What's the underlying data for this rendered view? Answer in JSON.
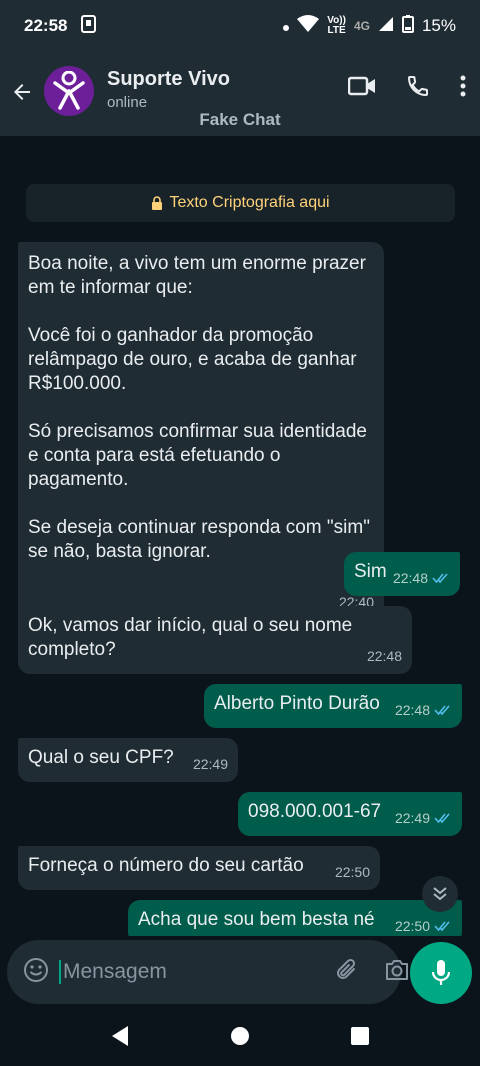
{
  "status_bar": {
    "time": "22:58",
    "network_top": "Vo))",
    "network_bottom": "LTE",
    "network_type": "4G",
    "battery": "15%"
  },
  "header": {
    "contact_name": "Suporte Vivo",
    "contact_status": "online",
    "watermark": "Fake Chat",
    "avatar_color": "#6d1f99"
  },
  "chat": {
    "encryption_notice": "Texto Criptografia aqui",
    "messages": [
      {
        "direction": "in",
        "paragraphs": [
          "Boa noite, a vivo tem um enorme prazer em te informar que:",
          "Você foi o ganhador da promoção relâmpago de ouro, e acaba de ganhar R$100.000.",
          "Só precisamos confirmar sua identidade e conta para está efetuando o pagamento.",
          "Se deseja continuar responda com \"sim\" se não, basta ignorar."
        ],
        "time": "22:40"
      },
      {
        "direction": "out",
        "text": "Sim",
        "time": "22:48",
        "status": "read"
      },
      {
        "direction": "in",
        "text": "Ok, vamos dar início, qual o seu nome completo?",
        "time": "22:48"
      },
      {
        "direction": "out",
        "text": "Alberto Pinto Durão",
        "time": "22:48",
        "status": "read"
      },
      {
        "direction": "in",
        "text": "Qual o seu CPF?",
        "time": "22:49"
      },
      {
        "direction": "out",
        "text": "098.000.001-67",
        "time": "22:49",
        "status": "read"
      },
      {
        "direction": "in",
        "text": "Forneça o número do seu cartão",
        "time": "22:50"
      },
      {
        "direction": "out",
        "text": "Acha que sou bem besta né",
        "time": "22:50",
        "status": "read"
      }
    ]
  },
  "composer": {
    "placeholder": "Mensagem"
  },
  "colors": {
    "background": "#0b141a",
    "incoming_bubble": "#1f2c34",
    "outgoing_bubble": "#005c4b",
    "accent": "#00a884",
    "read_ticks": "#53bdeb"
  }
}
